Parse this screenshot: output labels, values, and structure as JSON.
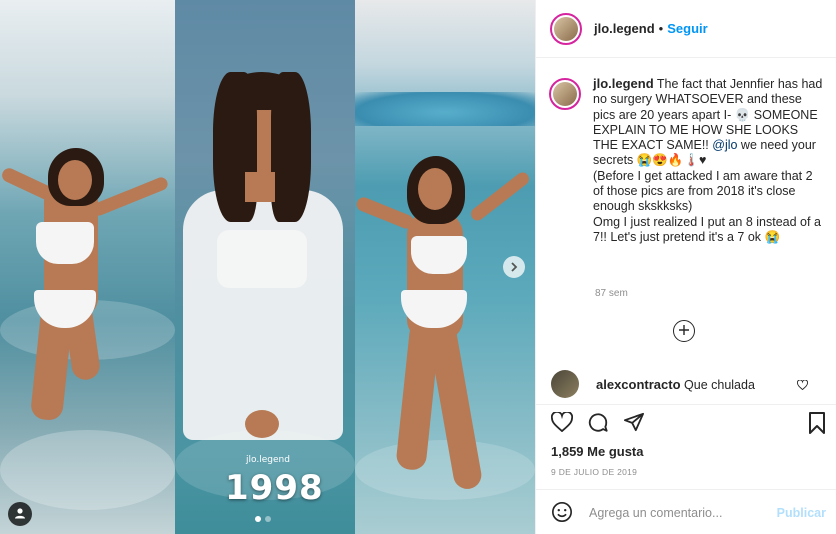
{
  "post": {
    "year_overlay": "1998",
    "watermark": "jlo.legend"
  },
  "header": {
    "username": "jlo.legend",
    "separator": "•",
    "follow_label": "Seguir"
  },
  "caption": {
    "username": "jlo.legend",
    "text_part1": "The fact that Jennfier has had no surgery WHATSOEVER and these pics are 20 years apart I- 💀 SOMEONE EXPLAIN TO ME HOW SHE LOOKS THE EXACT SAME!! ",
    "mention": "@jlo",
    "text_part2": " we need your secrets 😭😍🔥🌡️♥",
    "line2": "(Before I get attacked I am aware that 2 of those pics are from 2018 it's close enough skskksks)",
    "line3": "Omg I just realized I put an 8 instead of a 7!! Let's just pretend it's a 7 ok 😭",
    "time": "87 sem"
  },
  "comments": [
    {
      "username": "alexcontracto",
      "text": "Que chulada"
    }
  ],
  "likes": "1,859 Me gusta",
  "date": "9 DE JULIO DE 2019",
  "add_comment": {
    "placeholder": "Agrega un comentario...",
    "publish_label": "Publicar"
  },
  "colors": {
    "link": "#0095f6",
    "publish_disabled": "#b2dffc",
    "muted": "#8e8e8e"
  }
}
